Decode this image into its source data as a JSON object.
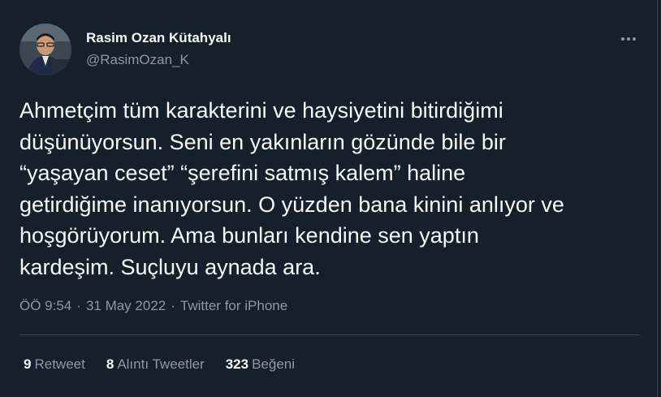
{
  "author": {
    "name": "Rasim Ozan Kütahyalı",
    "handle": "@RasimOzan_K"
  },
  "tweet": {
    "text": "Ahmetçim tüm karakterini ve haysiyetini bitirdiğimi\ndüşünüyorsun. Seni en yakınların gözünde bile bir\n“yaşayan ceset” “şerefini satmış kalem” haline\ngetirdiğime inanıyorsun. O yüzden bana kinini anlıyor ve\nhoşgörüyorum. Ama bunları kendine sen yaptın\nkardeşim. Suçluyu aynada ara.",
    "time": "ÖÖ 9:54",
    "date": "31 May 2022",
    "separator": "·",
    "source": "Twitter for iPhone"
  },
  "stats": {
    "retweets": {
      "count": "9",
      "label": "Retweet"
    },
    "quotes": {
      "count": "8",
      "label": "Alıntı Tweetler"
    },
    "likes": {
      "count": "323",
      "label": "Beğeni"
    }
  },
  "icons": {
    "more": "more-horizontal-icon"
  },
  "colors": {
    "background": "#15202b",
    "text_primary": "#f7f9f9",
    "text_secondary": "#8b98a5",
    "divider": "#38444d"
  }
}
